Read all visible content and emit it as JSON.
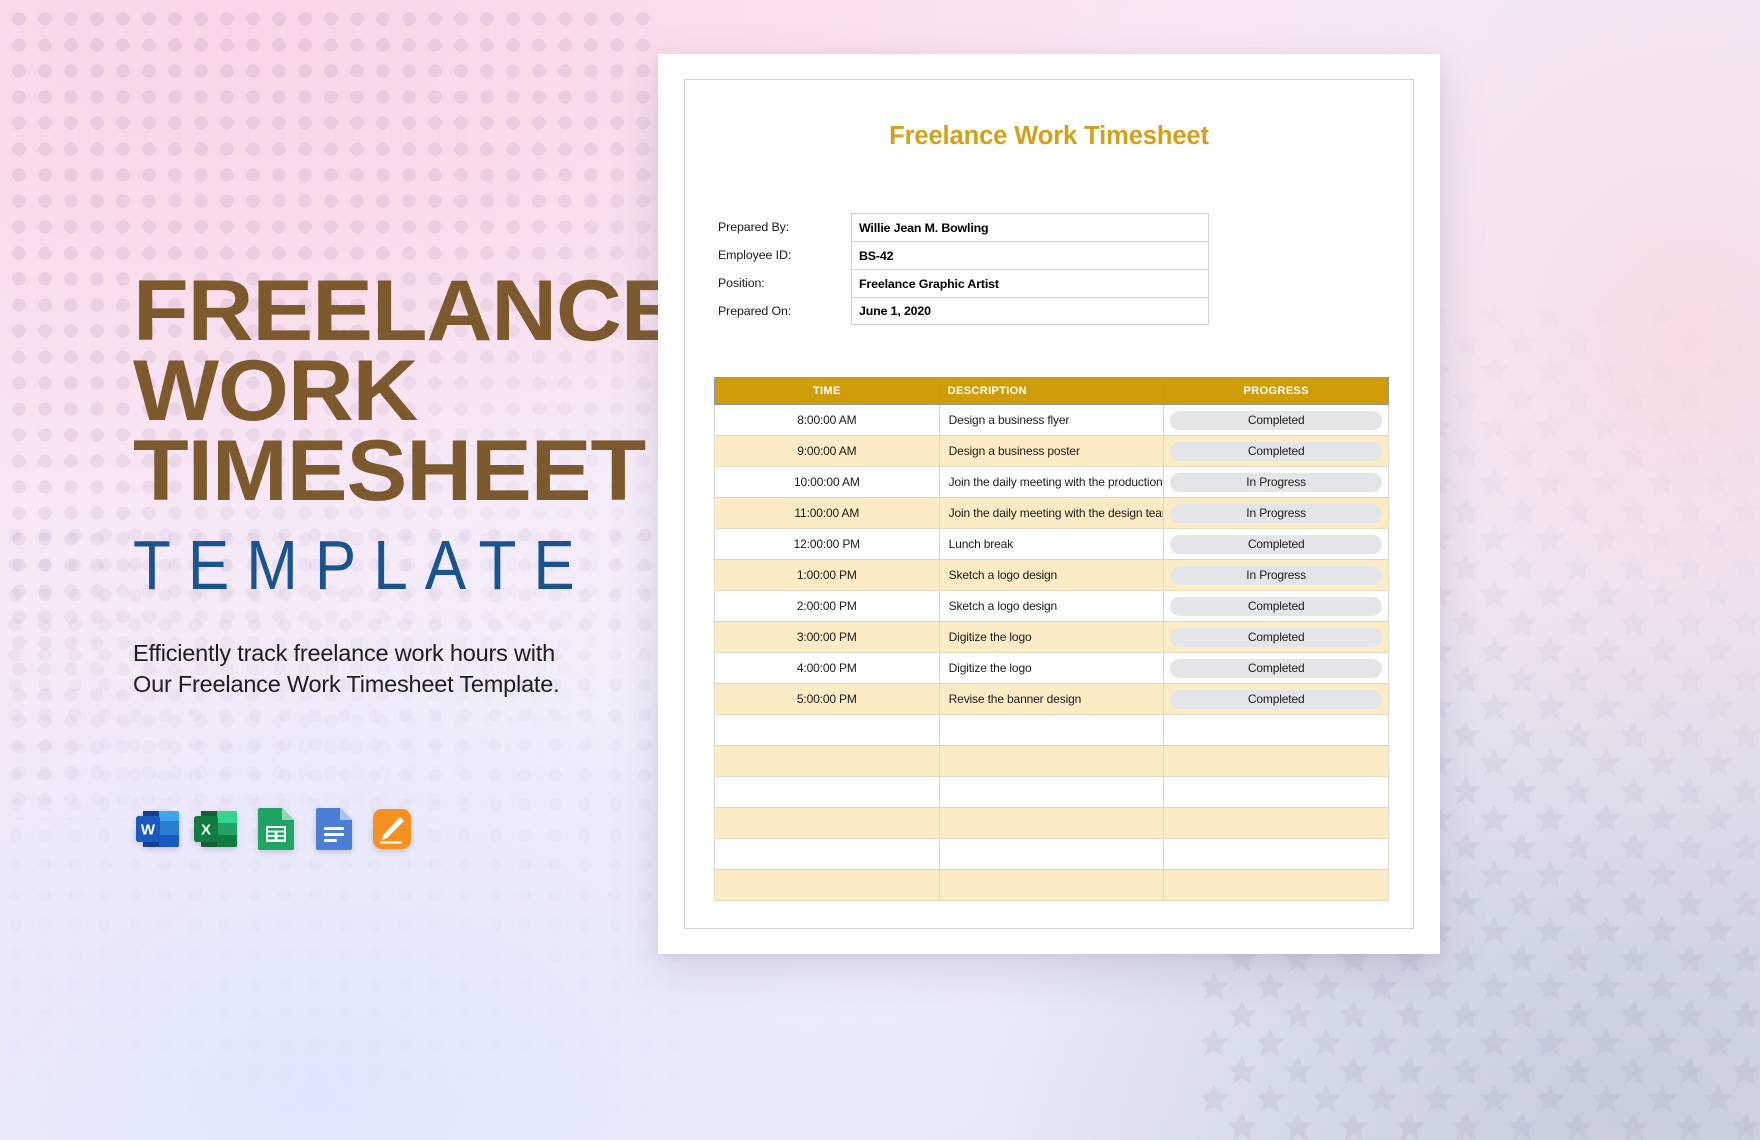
{
  "branding": {
    "line1": "FREELANCE",
    "line2": "WORK",
    "line3": "TIMESHEET",
    "template_word": "TEMPLATE",
    "tagline_line1": "Efficiently track freelance work hours with",
    "tagline_line2": "Our Freelance Work Timesheet Template.",
    "heading_color": "#7d5a2e",
    "template_color": "#1a5490"
  },
  "app_icons": [
    {
      "name": "microsoft-word-icon",
      "label": "W"
    },
    {
      "name": "microsoft-excel-icon",
      "label": "X"
    },
    {
      "name": "google-sheets-icon",
      "label": ""
    },
    {
      "name": "google-docs-icon",
      "label": ""
    },
    {
      "name": "apple-pages-icon",
      "label": ""
    }
  ],
  "document": {
    "title": "Freelance Work Timesheet",
    "title_color": "#d4a017",
    "info_fields": [
      {
        "label": "Prepared By:",
        "value": "Willie Jean M. Bowling"
      },
      {
        "label": "Employee ID:",
        "value": "BS-42"
      },
      {
        "label": "Position:",
        "value": "Freelance Graphic Artist"
      },
      {
        "label": "Prepared On:",
        "value": "June 1, 2020"
      }
    ],
    "table": {
      "header_color": "#cf9d09",
      "alt_row_color": "#fcecc6",
      "pill_color": "#e4e5e8",
      "columns": [
        "TIME",
        "DESCRIPTION",
        "PROGRESS"
      ],
      "rows": [
        {
          "time": "8:00:00 AM",
          "description": "Design a business flyer",
          "progress": "Completed"
        },
        {
          "time": "9:00:00 AM",
          "description": "Design a business poster",
          "progress": "Completed"
        },
        {
          "time": "10:00:00 AM",
          "description": "Join the daily meeting with the production team",
          "progress": "In Progress"
        },
        {
          "time": "11:00:00 AM",
          "description": "Join the daily meeting with the design team",
          "progress": "In Progress"
        },
        {
          "time": "12:00:00 PM",
          "description": "Lunch break",
          "progress": "Completed"
        },
        {
          "time": "1:00:00 PM",
          "description": "Sketch a logo design",
          "progress": "In Progress"
        },
        {
          "time": "2:00:00 PM",
          "description": "Sketch a logo design",
          "progress": "Completed"
        },
        {
          "time": "3:00:00 PM",
          "description": "Digitize the logo",
          "progress": "Completed"
        },
        {
          "time": "4:00:00 PM",
          "description": "Digitize the logo",
          "progress": "Completed"
        },
        {
          "time": "5:00:00 PM",
          "description": "Revise the banner design",
          "progress": "Completed"
        },
        {
          "time": "",
          "description": "",
          "progress": ""
        },
        {
          "time": "",
          "description": "",
          "progress": ""
        },
        {
          "time": "",
          "description": "",
          "progress": ""
        },
        {
          "time": "",
          "description": "",
          "progress": ""
        },
        {
          "time": "",
          "description": "",
          "progress": ""
        },
        {
          "time": "",
          "description": "",
          "progress": ""
        }
      ]
    }
  }
}
